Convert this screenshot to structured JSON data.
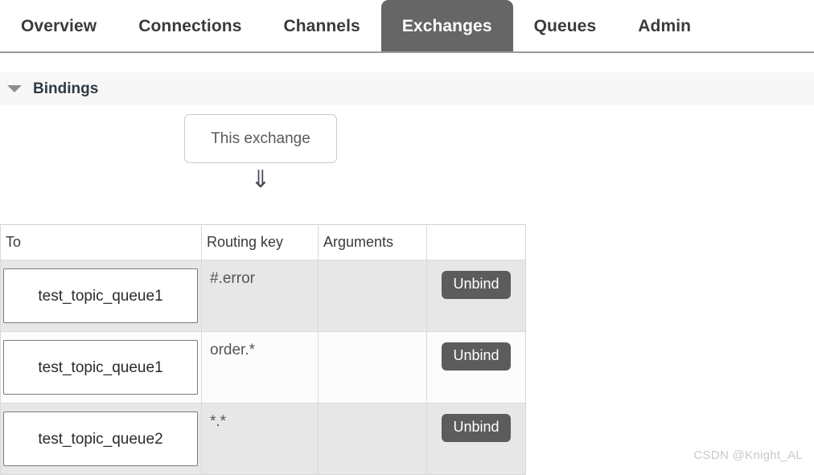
{
  "nav": {
    "tabs": [
      {
        "label": "Overview",
        "active": false
      },
      {
        "label": "Connections",
        "active": false
      },
      {
        "label": "Channels",
        "active": false
      },
      {
        "label": "Exchanges",
        "active": true
      },
      {
        "label": "Queues",
        "active": false
      },
      {
        "label": "Admin",
        "active": false
      }
    ],
    "active_tab_color": "#666666"
  },
  "bindings_section": {
    "title": "Bindings",
    "caret_icon": "triangle-down-icon",
    "collapsed": false
  },
  "diagram": {
    "source_node_label": "This exchange",
    "arrow_glyph": "⇓",
    "arrow_icon": "double-down-arrow-icon"
  },
  "table": {
    "columns": [
      "To",
      "Routing key",
      "Arguments",
      ""
    ],
    "rows": [
      {
        "to": "test_topic_queue1",
        "routing_key": "#.error",
        "arguments": "",
        "action_label": "Unbind"
      },
      {
        "to": "test_topic_queue1",
        "routing_key": "order.*",
        "arguments": "",
        "action_label": "Unbind"
      },
      {
        "to": "test_topic_queue2",
        "routing_key": "*.*",
        "arguments": "",
        "action_label": "Unbind"
      }
    ]
  },
  "watermark": {
    "text": "CSDN @Knight_AL"
  }
}
